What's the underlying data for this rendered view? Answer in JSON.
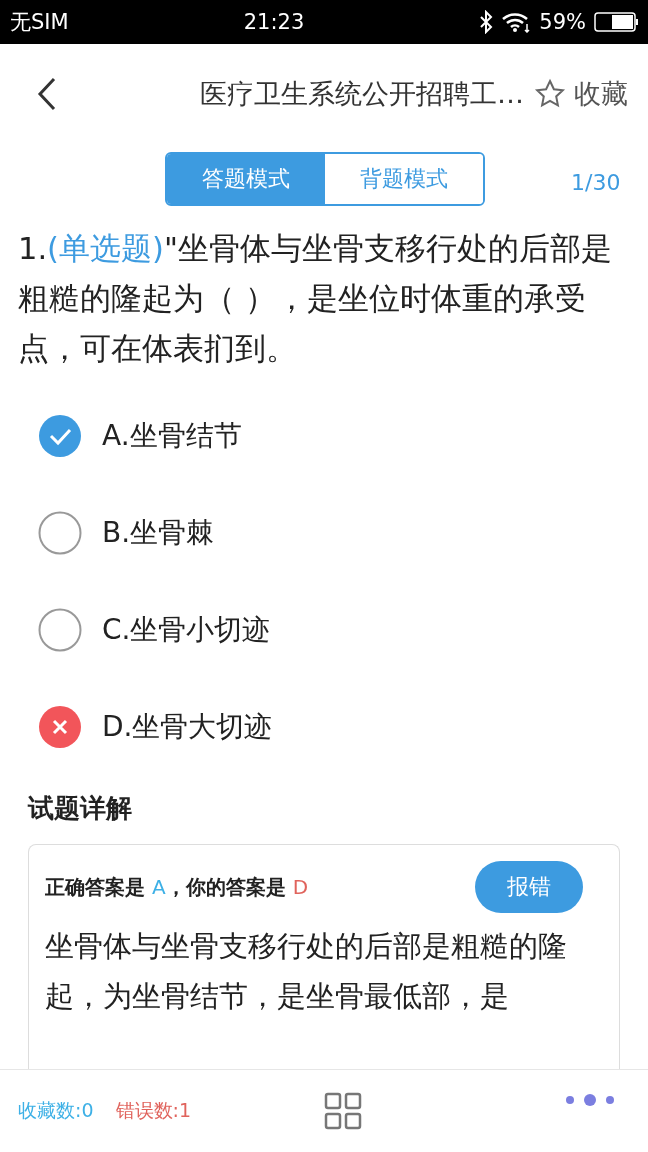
{
  "status_bar": {
    "carrier": "无SIM",
    "time": "21:23",
    "battery": "59%"
  },
  "header": {
    "title": "医疗卫生系统公开招聘工…",
    "favorite": "收藏"
  },
  "mode_tabs": [
    {
      "label": "答题模式",
      "selected": true
    },
    {
      "label": "背题模式",
      "selected": false
    }
  ],
  "progress": "1/30",
  "question": {
    "number": "1.",
    "type": "(单选题)",
    "text": "\"坐骨体与坐骨支移行处的后部是粗糙的隆起为（ ），是坐位时体重的承受点，可在体表扪到。"
  },
  "options": [
    {
      "label": "A.坐骨结节",
      "kind": "correct"
    },
    {
      "label": "B.坐骨棘",
      "kind": "plain"
    },
    {
      "label": "C.坐骨小切迹",
      "kind": "plain"
    },
    {
      "label": "D.坐骨大切迹",
      "kind": "wrong"
    }
  ],
  "explanation": {
    "heading": "试题详解",
    "answer_prefix": "正确答案是 ",
    "correct": "A",
    "answer_middle": "，你的答案是 ",
    "yours": "D",
    "report_button": "报错",
    "text": "坐骨体与坐骨支移行处的后部是粗糙的隆起，为坐骨结节，是坐骨最低部，是"
  },
  "bottom_bar": {
    "favorites": "收藏数:0",
    "errors": "错误数:1"
  }
}
